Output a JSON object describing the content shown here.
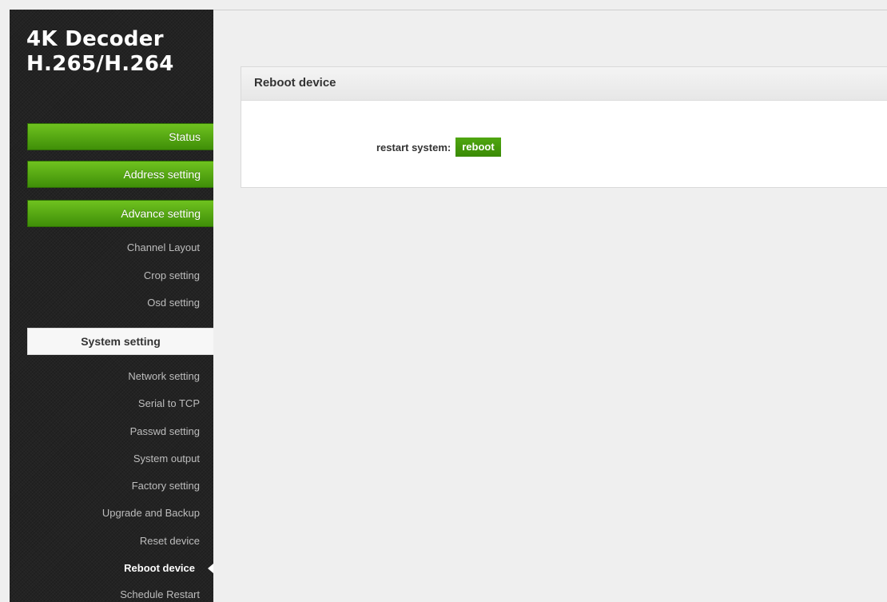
{
  "brand": {
    "line1": "4K Decoder",
    "line2": "H.265/H.264"
  },
  "menu": {
    "status": "Status",
    "address_setting": "Address setting",
    "advance_setting": "Advance setting",
    "advance_items": [
      "Channel Layout",
      "Crop setting",
      "Osd setting"
    ],
    "system_setting": "System setting",
    "system_items": [
      "Network setting",
      "Serial to TCP",
      "Passwd setting",
      "System output",
      "Factory setting",
      "Upgrade and Backup",
      "Reset device",
      "Reboot device",
      "Schedule Restart"
    ],
    "current_item": "Reboot device"
  },
  "panel": {
    "title": "Reboot device",
    "restart_label": "restart system:",
    "reboot_button": "reboot"
  },
  "colors": {
    "accent_green": "#4fa611",
    "sidebar_bg": "#232323",
    "page_bg": "#efefef"
  }
}
